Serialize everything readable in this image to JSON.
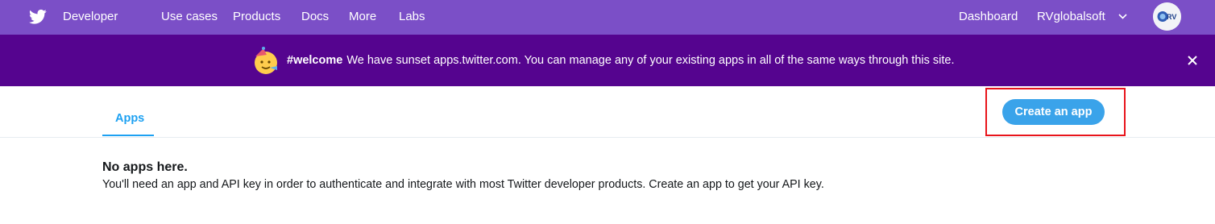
{
  "topnav": {
    "brand": "Developer",
    "links": [
      "Use cases",
      "Products",
      "Docs",
      "More",
      "Labs"
    ],
    "dashboard": "Dashboard",
    "account": "RVglobalsoft",
    "avatar_text": "RV",
    "background": "#7b4fc7"
  },
  "banner": {
    "hashtag": "#welcome",
    "message": "We have sunset apps.twitter.com. You can manage any of your existing apps in all of the same ways through this site.",
    "background": "#55048f"
  },
  "tabs": [
    {
      "label": "Apps",
      "active": true
    }
  ],
  "actions": {
    "create_app_label": "Create an app",
    "accent": "#1da1f2"
  },
  "empty_state": {
    "title": "No apps here.",
    "description": "You'll need an app and API key in order to authenticate and integrate with most Twitter developer products. Create an app to get your API key."
  },
  "icons": {
    "logo": "twitter-bird-icon",
    "banner_emoji": "party-face-icon",
    "close": "close-icon",
    "dropdown": "chevron-down-icon"
  }
}
